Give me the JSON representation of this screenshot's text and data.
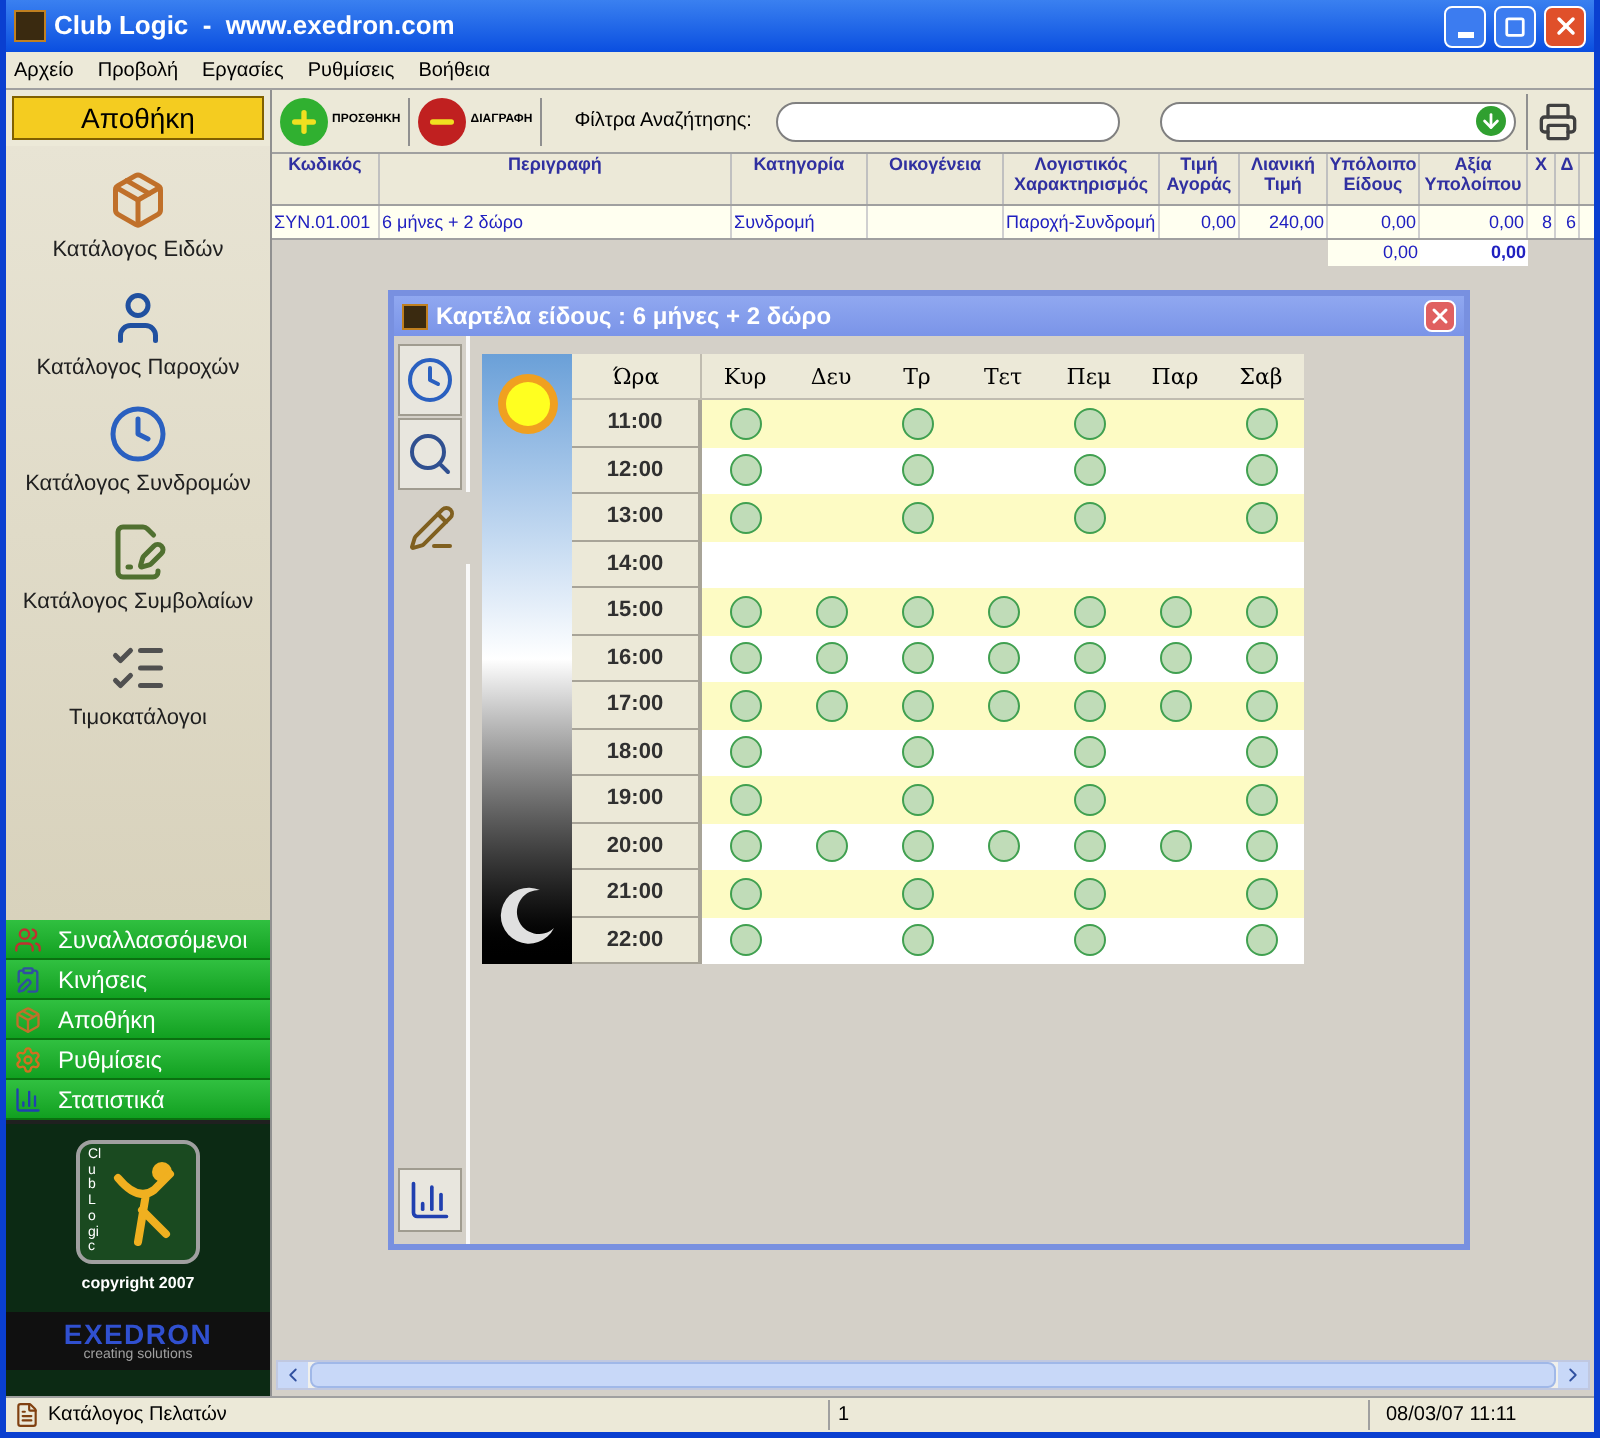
{
  "window": {
    "title": "Club Logic  -  www.exedron.com"
  },
  "menu": [
    "Αρχείο",
    "Προβολή",
    "Εργασίες",
    "Ρυθμίσεις",
    "Βοήθεια"
  ],
  "sidebar": {
    "header": "Αποθήκη",
    "items": [
      {
        "label": "Κατάλογος Ειδών",
        "kind": "box"
      },
      {
        "label": "Κατάλογος Παροχών",
        "kind": "person"
      },
      {
        "label": "Κατάλογος Συνδρομών",
        "kind": "clock"
      },
      {
        "label": "Κατάλογος Συμβολαίων",
        "kind": "contract"
      },
      {
        "label": "Τιμοκατάλογοι",
        "kind": "list"
      }
    ],
    "nav": [
      {
        "label": "Συναλλασσόμενοι",
        "kind": "people"
      },
      {
        "label": "Κινήσεις",
        "kind": "moves"
      },
      {
        "label": "Αποθήκη",
        "kind": "box"
      },
      {
        "label": "Ρυθμίσεις",
        "kind": "settings"
      },
      {
        "label": "Στατιστικά",
        "kind": "stats"
      }
    ],
    "logo": {
      "name": "Club Logic",
      "copyright": "copyright 2007",
      "brand": "EXEDRON",
      "tagline": "creating solutions"
    }
  },
  "toolbar": {
    "add": "ΠΡΟΣΘΗΚΗ",
    "delete": "ΔΙΑΓΡΑΦΗ",
    "filter_label": "Φίλτρα Αναζήτησης:"
  },
  "table": {
    "columns": [
      "Κωδικός",
      "Περιγραφή",
      "Κατηγορία",
      "Οικογένεια",
      "Λογιστικός Χαρακτηρισμός",
      "Τιμή Αγοράς",
      "Λιανική Τιμή",
      "Υπόλοιπο Είδους",
      "Αξία Υπολοίπου",
      "Χ",
      "Δ"
    ],
    "rows": [
      [
        "ΣΥΝ.01.001",
        "6 μήνες + 2 δώρο",
        "Συνδρομή",
        "",
        "Παροχή-Συνδρομή",
        "0,00",
        "240,00",
        "0,00",
        "0,00",
        "8",
        "6"
      ]
    ],
    "totals": {
      "balance": "0,00",
      "value": "0,00"
    }
  },
  "dialog": {
    "title": "Καρτέλα είδους : 6 μήνες + 2 δώρο",
    "tabs": [
      {
        "kind": "clock",
        "selected": false
      },
      {
        "kind": "search",
        "selected": false
      },
      {
        "kind": "edit",
        "selected": true
      }
    ],
    "bottom_tab": {
      "kind": "stats"
    },
    "schedule": {
      "hour_header": "Ώρα",
      "days": [
        "Κυρ",
        "Δευ",
        "Τρ",
        "Τετ",
        "Πεμ",
        "Παρ",
        "Σαβ"
      ],
      "rows": [
        {
          "hour": "11:00",
          "slots": [
            true,
            false,
            true,
            false,
            true,
            false,
            true
          ]
        },
        {
          "hour": "12:00",
          "slots": [
            true,
            false,
            true,
            false,
            true,
            false,
            true
          ]
        },
        {
          "hour": "13:00",
          "slots": [
            true,
            false,
            true,
            false,
            true,
            false,
            true
          ]
        },
        {
          "hour": "14:00",
          "slots": [
            false,
            false,
            false,
            false,
            false,
            false,
            false
          ]
        },
        {
          "hour": "15:00",
          "slots": [
            true,
            true,
            true,
            true,
            true,
            true,
            true
          ]
        },
        {
          "hour": "16:00",
          "slots": [
            true,
            true,
            true,
            true,
            true,
            true,
            true
          ]
        },
        {
          "hour": "17:00",
          "slots": [
            true,
            true,
            true,
            true,
            true,
            true,
            true
          ]
        },
        {
          "hour": "18:00",
          "slots": [
            true,
            false,
            true,
            false,
            true,
            false,
            true
          ]
        },
        {
          "hour": "19:00",
          "slots": [
            true,
            false,
            true,
            false,
            true,
            false,
            true
          ]
        },
        {
          "hour": "20:00",
          "slots": [
            true,
            true,
            true,
            true,
            true,
            true,
            true
          ]
        },
        {
          "hour": "21:00",
          "slots": [
            true,
            false,
            true,
            false,
            true,
            false,
            true
          ]
        },
        {
          "hour": "22:00",
          "slots": [
            true,
            false,
            true,
            false,
            true,
            false,
            true
          ]
        }
      ]
    }
  },
  "status_bar": {
    "text": "Κατάλογος Πελατών",
    "count": "1",
    "datetime": "08/03/07 11:11"
  }
}
